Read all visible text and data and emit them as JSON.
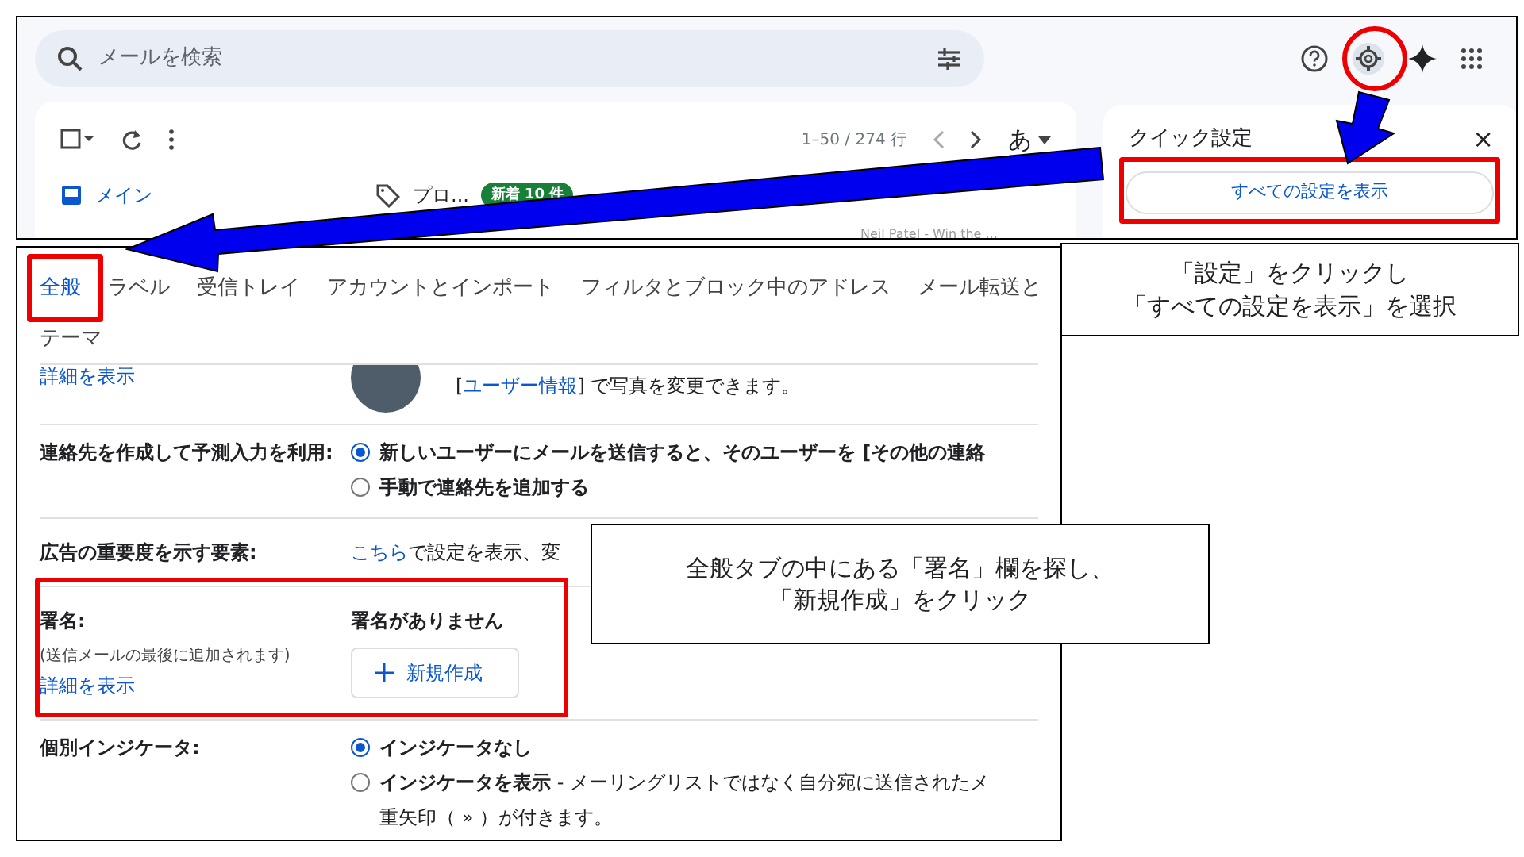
{
  "inbox_screen": {
    "search": {
      "placeholder": "メールを検索"
    },
    "pagination": "1–50 / 274 行",
    "input_mode": "あ",
    "categories": [
      {
        "label": "メイン",
        "selected": true
      },
      {
        "label": "プロ...",
        "badge": "新着 10 件",
        "selected": false
      }
    ],
    "sender_preview": "Neil Patel - Win the ..."
  },
  "quick_settings": {
    "title": "クイック設定",
    "close": "×",
    "button": "すべての設定を表示"
  },
  "settings_screen": {
    "tabs": [
      {
        "label": "全般",
        "selected": true
      },
      {
        "label": "ラベル",
        "selected": false
      },
      {
        "label": "受信トレイ",
        "selected": false
      },
      {
        "label": "アカウントとインポート",
        "selected": false
      },
      {
        "label": "フィルタとブロック中のアドレス",
        "selected": false
      },
      {
        "label": "メール転送と",
        "selected": false
      },
      {
        "label": "テーマ",
        "selected": false
      }
    ],
    "picture_row": {
      "link": "詳細を表示",
      "note_prefix": "[",
      "note_link": "ユーザー情報",
      "note_suffix": "] で写真を変更できます。"
    },
    "rows": [
      {
        "kind": "radios",
        "label": "連絡先を作成して予測入力を利用:",
        "options": [
          {
            "text": "新しいユーザーにメールを送信すると、そのユーザーを [その他の連絡",
            "selected": true
          },
          {
            "text": "手動で連絡先を追加する",
            "selected": false
          }
        ]
      },
      {
        "kind": "link_text",
        "label": "広告の重要度を示す要素:",
        "link": "こちら",
        "text": "で設定を表示、変"
      },
      {
        "kind": "signature",
        "label": "署名:",
        "sublabel": "(送信メールの最後に追加されます)",
        "link": "詳細を表示",
        "value": "署名がありません",
        "button": "新規作成"
      },
      {
        "kind": "radios",
        "label": "個別インジケータ:",
        "options": [
          {
            "text": "インジケータなし",
            "selected": true
          },
          {
            "text": "**インジケータを表示** - メーリングリストではなく自分宛に送信されたメ",
            "continuation": "重矢印（ » ）が付きます。",
            "selected": false
          }
        ]
      }
    ]
  },
  "callouts": [
    {
      "lines": [
        "「設定」をクリックし",
        "「すべての設定を表示」を選択"
      ]
    },
    {
      "lines": [
        "全般タブの中にある「署名」欄を探し、",
        "「新規作成」をクリック"
      ]
    }
  ]
}
